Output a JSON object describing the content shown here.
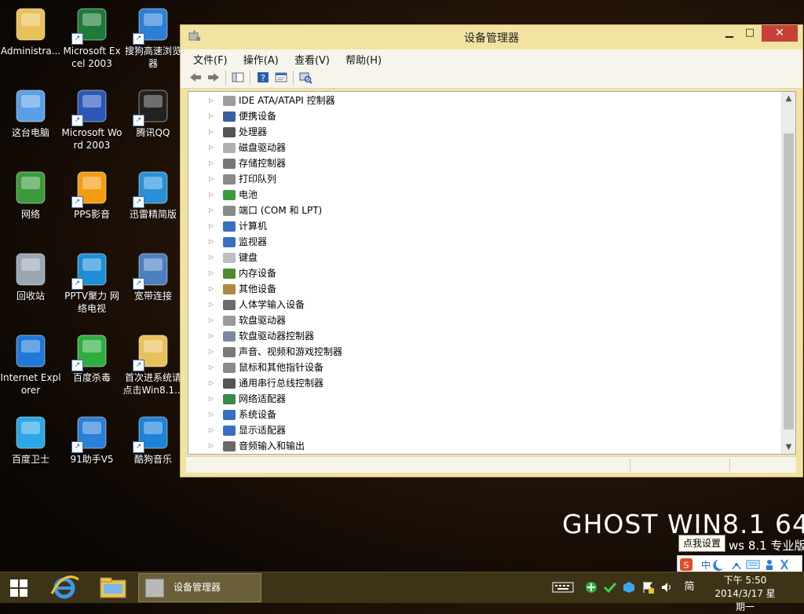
{
  "desktop": {
    "icons": [
      {
        "label": "Administra...",
        "glyph": "user-folder-icon",
        "color": "#e8c15a"
      },
      {
        "label": "Microsoft Excel 2003",
        "glyph": "excel-icon",
        "color": "#1f7a3a"
      },
      {
        "label": "搜狗高速浏览器",
        "glyph": "sogou-browser-icon",
        "color": "#2b7fd6"
      },
      {
        "label": "这台电脑",
        "glyph": "computer-icon",
        "color": "#5aa0e6"
      },
      {
        "label": "Microsoft Word 2003",
        "glyph": "word-icon",
        "color": "#2b57b8"
      },
      {
        "label": "腾讯QQ",
        "glyph": "qq-icon",
        "color": "#222"
      },
      {
        "label": "网络",
        "glyph": "network-icon",
        "color": "#3c9a3c"
      },
      {
        "label": "PPS影音",
        "glyph": "pps-icon",
        "color": "#f39c12"
      },
      {
        "label": "迅雷精简版",
        "glyph": "xunlei-icon",
        "color": "#2a8fd8"
      },
      {
        "label": "回收站",
        "glyph": "recycle-bin-icon",
        "color": "#9aa6b2"
      },
      {
        "label": "PPTV聚力 网络电视",
        "glyph": "pptv-icon",
        "color": "#1e8ed8"
      },
      {
        "label": "宽带连接",
        "glyph": "broadband-icon",
        "color": "#4a7fc0"
      },
      {
        "label": "Internet Explorer",
        "glyph": "ie-icon",
        "color": "#1e78d8"
      },
      {
        "label": "百度杀毒",
        "glyph": "baidu-antivirus-icon",
        "color": "#2fae3f"
      },
      {
        "label": "首次进系统请点击Win8.1...",
        "glyph": "folder-icon",
        "color": "#e8c15a"
      },
      {
        "label": "百度卫士",
        "glyph": "baidu-guard-icon",
        "color": "#2ba6e6"
      },
      {
        "label": "91助手V5",
        "glyph": "91-assistant-icon",
        "color": "#2a7fd6"
      },
      {
        "label": "酷狗音乐",
        "glyph": "kugou-icon",
        "color": "#1b83d8"
      }
    ]
  },
  "window": {
    "title": "设备管理器",
    "controls": {
      "minimize": "▁",
      "maximize": "□",
      "close": "✕"
    },
    "menu": [
      "文件(F)",
      "操作(A)",
      "查看(V)",
      "帮助(H)"
    ],
    "tree": [
      {
        "label": "IDE ATA/ATAPI 控制器",
        "icon": "ide-controller-icon",
        "color": "#9e9e9e"
      },
      {
        "label": "便携设备",
        "icon": "portable-device-icon",
        "color": "#3a5fa0"
      },
      {
        "label": "处理器",
        "icon": "processor-icon",
        "color": "#555555"
      },
      {
        "label": "磁盘驱动器",
        "icon": "disk-drive-icon",
        "color": "#b0b0b0"
      },
      {
        "label": "存储控制器",
        "icon": "storage-controller-icon",
        "color": "#777777"
      },
      {
        "label": "打印队列",
        "icon": "printer-icon",
        "color": "#8a8a8a"
      },
      {
        "label": "电池",
        "icon": "battery-icon",
        "color": "#3c9a3c"
      },
      {
        "label": "端口 (COM 和 LPT)",
        "icon": "port-icon",
        "color": "#8a8a8a"
      },
      {
        "label": "计算机",
        "icon": "computer-icon",
        "color": "#3a6fc0"
      },
      {
        "label": "监视器",
        "icon": "monitor-icon",
        "color": "#3a6fc0"
      },
      {
        "label": "键盘",
        "icon": "keyboard-icon",
        "color": "#bdbdbd"
      },
      {
        "label": "内存设备",
        "icon": "memory-icon",
        "color": "#4e8a2e"
      },
      {
        "label": "其他设备",
        "icon": "other-device-icon",
        "color": "#b08a40"
      },
      {
        "label": "人体学输入设备",
        "icon": "hid-icon",
        "color": "#6a6a6a"
      },
      {
        "label": "软盘驱动器",
        "icon": "floppy-drive-icon",
        "color": "#9a9a9a"
      },
      {
        "label": "软盘驱动器控制器",
        "icon": "floppy-controller-icon",
        "color": "#7a8aa0"
      },
      {
        "label": "声音、视频和游戏控制器",
        "icon": "sound-icon",
        "color": "#7a7a7a"
      },
      {
        "label": "鼠标和其他指针设备",
        "icon": "mouse-icon",
        "color": "#8a8a8a"
      },
      {
        "label": "通用串行总线控制器",
        "icon": "usb-icon",
        "color": "#555555"
      },
      {
        "label": "网络适配器",
        "icon": "network-adapter-icon",
        "color": "#3a8a4a"
      },
      {
        "label": "系统设备",
        "icon": "system-device-icon",
        "color": "#3a6fc0"
      },
      {
        "label": "显示适配器",
        "icon": "display-adapter-icon",
        "color": "#3a6fc0"
      },
      {
        "label": "音频输入和输出",
        "icon": "audio-io-icon",
        "color": "#6a6a6a"
      }
    ]
  },
  "wallpaper": {
    "headline": "GHOST WIN8.1 64",
    "edition": "ws 8.1 专业版"
  },
  "tooltip": "点我设置",
  "taskbar": {
    "active_task": "设备管理器",
    "ime_label": "简",
    "clock_time": "下午 5:50",
    "clock_date": "2014/3/17 星期一"
  },
  "colors": {
    "window_frame": "#f2e3a0",
    "close_button": "#c7413a",
    "taskbar": "#3d3418"
  }
}
